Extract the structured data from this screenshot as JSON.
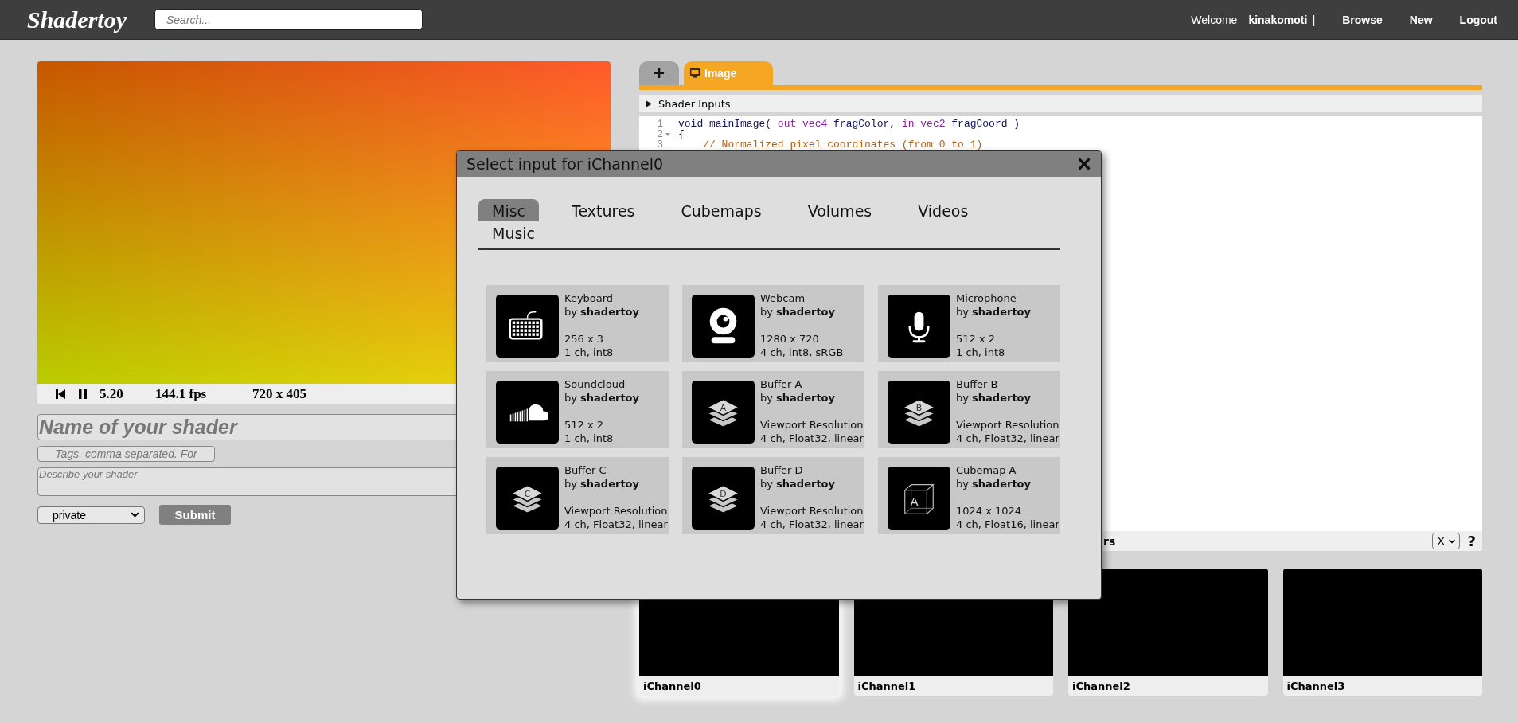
{
  "header": {
    "logo": "Shadertoy",
    "search": {
      "placeholder": "Search..."
    },
    "welcome": "Welcome",
    "user": "kinakomoti",
    "separator": "|",
    "links": [
      "Browse",
      "New",
      "Logout"
    ]
  },
  "player": {
    "time": "5.20",
    "fps": "144.1 fps",
    "resolution": "720 x 405"
  },
  "form": {
    "name": {
      "placeholder": "Name of your shader"
    },
    "tags": {
      "placeholder": "Tags, comma separated. For"
    },
    "description": {
      "placeholder": "Describe your shader"
    },
    "visibility": "private",
    "submit": "Submit"
  },
  "editor": {
    "tabs": [
      {
        "kind": "add",
        "label": "+",
        "selected": false
      },
      {
        "kind": "pass",
        "label": "Image",
        "selected": true
      }
    ],
    "shader_inputs": {
      "label": "Shader Inputs",
      "expanded": false
    },
    "lines": [
      {
        "number": "1",
        "foldable": false,
        "tokens": [
          {
            "kind": "type",
            "text": "void"
          },
          {
            "kind": "plain",
            "text": " mainImage( "
          },
          {
            "kind": "keyword",
            "text": "out"
          },
          {
            "kind": "keyword",
            "text": " vec4"
          },
          {
            "kind": "plain",
            "text": " fragColor, "
          },
          {
            "kind": "keyword",
            "text": "in"
          },
          {
            "kind": "keyword",
            "text": " vec2"
          },
          {
            "kind": "plain",
            "text": " fragCoord )"
          }
        ]
      },
      {
        "number": "2",
        "foldable": true,
        "tokens": [
          {
            "kind": "plain",
            "text": "{"
          }
        ]
      },
      {
        "number": "3",
        "foldable": false,
        "tokens": [
          {
            "kind": "comment",
            "text": "    // Normalized pixel coordinates (from 0 to 1)"
          }
        ]
      }
    ],
    "footer": {
      "label": "rs",
      "select": "X",
      "help": "?"
    }
  },
  "channels": [
    {
      "label": "iChannel0",
      "selected": true
    },
    {
      "label": "iChannel1",
      "selected": false
    },
    {
      "label": "iChannel2",
      "selected": false
    },
    {
      "label": "iChannel3",
      "selected": false
    }
  ],
  "dialog": {
    "title": "Select input for iChannel0",
    "tabs": [
      {
        "label": "Misc",
        "selected": true
      },
      {
        "label": "Textures",
        "selected": false
      },
      {
        "label": "Cubemaps",
        "selected": false
      },
      {
        "label": "Volumes",
        "selected": false
      },
      {
        "label": "Videos",
        "selected": false
      },
      {
        "label": "Music",
        "selected": false
      }
    ],
    "items": [
      {
        "kind": "keyboard",
        "name": "Keyboard",
        "author": "by **shadertoy**",
        "size": "256 x 3",
        "format": "1 ch, int8"
      },
      {
        "kind": "webcam",
        "name": "Webcam",
        "author": "by **shadertoy**",
        "size": "1280 x 720",
        "format": "4 ch, int8, sRGB"
      },
      {
        "kind": "microphone",
        "name": "Microphone",
        "author": "by **shadertoy**",
        "size": "512 x 2",
        "format": "1 ch, int8"
      },
      {
        "kind": "soundcloud",
        "name": "Soundcloud",
        "author": "by **shadertoy**",
        "size": "512 x 2",
        "format": "1 ch, int8"
      },
      {
        "kind": "buffer",
        "badge": "A",
        "name": "Buffer A",
        "author": "by **shadertoy**",
        "size": "Viewport Resolution",
        "format": "4 ch, Float32, linear"
      },
      {
        "kind": "buffer",
        "badge": "B",
        "name": "Buffer B",
        "author": "by **shadertoy**",
        "size": "Viewport Resolution",
        "format": "4 ch, Float32, linear"
      },
      {
        "kind": "buffer",
        "badge": "C",
        "name": "Buffer C",
        "author": "by **shadertoy**",
        "size": "Viewport Resolution",
        "format": "4 ch, Float32, linear"
      },
      {
        "kind": "buffer",
        "badge": "D",
        "name": "Buffer D",
        "author": "by **shadertoy**",
        "size": "Viewport Resolution",
        "format": "4 ch, Float32, linear"
      },
      {
        "kind": "cubemap",
        "badge": "A",
        "name": "Cubemap A",
        "author": "by **shadertoy**",
        "size": "1024 x 1024",
        "format": "4 ch, Float16, linear"
      }
    ]
  }
}
